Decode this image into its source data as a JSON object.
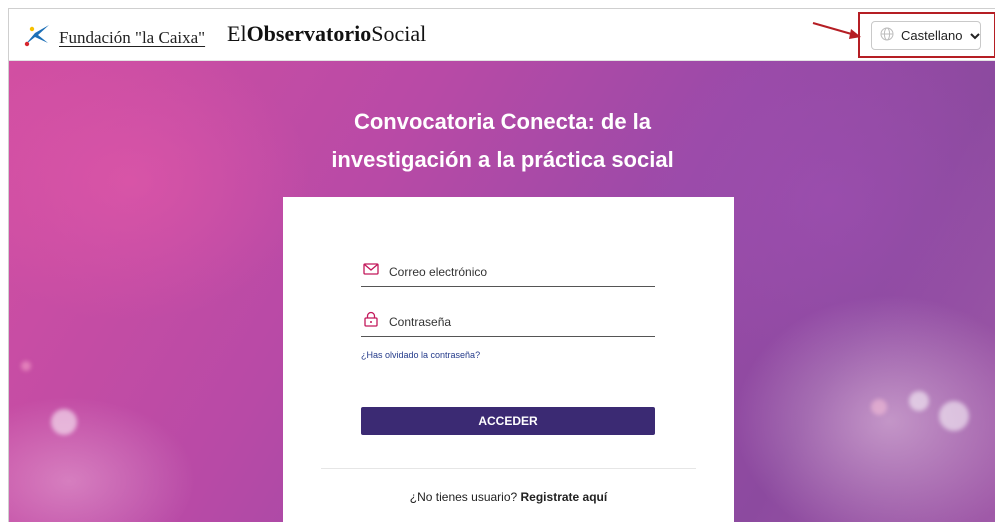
{
  "header": {
    "fundacion_label": "Fundación \"la Caixa\"",
    "observatorio_part1": "El",
    "observatorio_part2": "Observatorio",
    "observatorio_part3": "Social",
    "language": {
      "selected": "Castellano",
      "icon": "globe-icon",
      "chevron_icon": "chevron-down-icon"
    }
  },
  "hero": {
    "title_line1": "Convocatoria Conecta: de la",
    "title_line2": "investigación a la práctica social"
  },
  "login": {
    "email_placeholder": "Correo electrónico",
    "email_icon": "envelope-icon",
    "password_placeholder": "Contraseña",
    "password_icon": "lock-icon",
    "forgot_password": "¿Has olvidado la contraseña?",
    "submit_label": "ACCEDER",
    "signup_prompt": "¿No tienes usuario?",
    "signup_link": "Registrate aquí"
  },
  "colors": {
    "accent_button": "#3b2a73",
    "highlight_border": "#b51e24",
    "link": "#233a8a",
    "caixa_blue": "#1c6fb7",
    "caixa_red": "#d6262f",
    "caixa_yellow": "#f6c000"
  }
}
